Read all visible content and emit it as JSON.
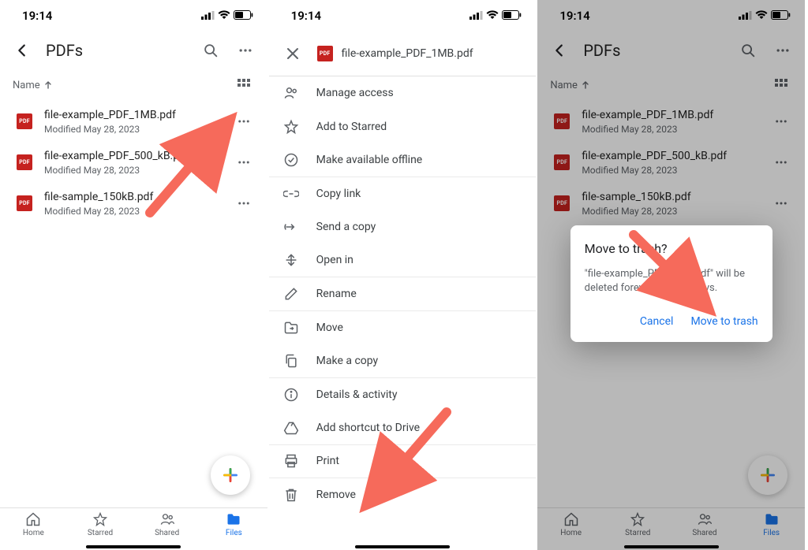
{
  "status": {
    "time": "19:14"
  },
  "screen1": {
    "title": "PDFs",
    "sort_label": "Name",
    "files": [
      {
        "name": "file-example_PDF_1MB.pdf",
        "modified": "Modified May 28, 2023"
      },
      {
        "name": "file-example_PDF_500_kB.pdf",
        "modified": "Modified May 28, 2023"
      },
      {
        "name": "file-sample_150kB.pdf",
        "modified": "Modified May 28, 2023"
      }
    ],
    "tabs": {
      "home": "Home",
      "starred": "Starred",
      "shared": "Shared",
      "files": "Files"
    },
    "pdf_badge": "PDF"
  },
  "screen2": {
    "filename": "file-example_PDF_1MB.pdf",
    "menu": {
      "manage_access": "Manage access",
      "add_starred": "Add to Starred",
      "make_offline": "Make available offline",
      "copy_link": "Copy link",
      "send_copy": "Send a copy",
      "open_in": "Open in",
      "rename": "Rename",
      "move": "Move",
      "make_copy": "Make a copy",
      "details": "Details & activity",
      "add_shortcut": "Add shortcut to Drive",
      "print": "Print",
      "remove": "Remove"
    }
  },
  "screen3": {
    "title": "PDFs",
    "sort_label": "Name",
    "files": [
      {
        "name": "file-example_PDF_1MB.pdf",
        "modified": "Modified May 28, 2023"
      },
      {
        "name": "file-example_PDF_500_kB.pdf",
        "modified": "Modified May 28, 2023"
      },
      {
        "name": "file-sample_150kB.pdf",
        "modified": "Modified May 28, 2023"
      }
    ],
    "tabs": {
      "home": "Home",
      "starred": "Starred",
      "shared": "Shared",
      "files": "Files"
    },
    "dialog": {
      "title": "Move to trash?",
      "body": "\"file-example_PDF_1MB.pdf\" will be deleted forever after 30 days.",
      "cancel": "Cancel",
      "confirm": "Move to trash"
    }
  }
}
